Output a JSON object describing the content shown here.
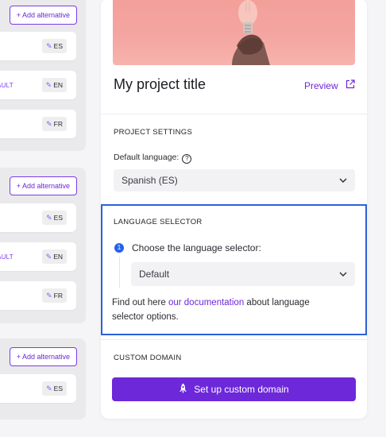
{
  "left_groups": [
    {
      "add_label": "+ Add alternative",
      "languages": [
        {
          "code": "ES",
          "is_default": false
        },
        {
          "code": "EN",
          "is_default": true
        },
        {
          "code": "FR",
          "is_default": false
        }
      ]
    },
    {
      "add_label": "+ Add alternative",
      "languages": [
        {
          "code": "ES",
          "is_default": false
        },
        {
          "code": "EN",
          "is_default": true
        },
        {
          "code": "FR",
          "is_default": false
        }
      ]
    },
    {
      "add_label": "+ Add alternative",
      "languages": [
        {
          "code": "ES",
          "is_default": false
        }
      ]
    }
  ],
  "default_tag": "DEFAULT",
  "edit_icon": "pencil-icon",
  "project": {
    "title": "My project title",
    "preview_label": "Preview",
    "preview_icon": "external-link-icon"
  },
  "project_settings": {
    "heading": "PROJECT SETTINGS",
    "default_language_label": "Default language:",
    "help_icon": "help-icon",
    "default_language_value": "Spanish (ES)"
  },
  "language_selector": {
    "heading": "LANGUAGE SELECTOR",
    "step_number": "1",
    "step_label": "Choose the language selector:",
    "selector_value": "Default",
    "help_prefix": "Find out here ",
    "help_link": "our documentation",
    "help_suffix": " about language selector options."
  },
  "custom_domain": {
    "heading": "CUSTOM DOMAIN",
    "button_label": "Set up custom domain",
    "button_icon": "rocket-icon"
  },
  "colors": {
    "accent": "#6d28d9",
    "highlight_border": "#2c62d8",
    "step_badge": "#2563eb"
  }
}
